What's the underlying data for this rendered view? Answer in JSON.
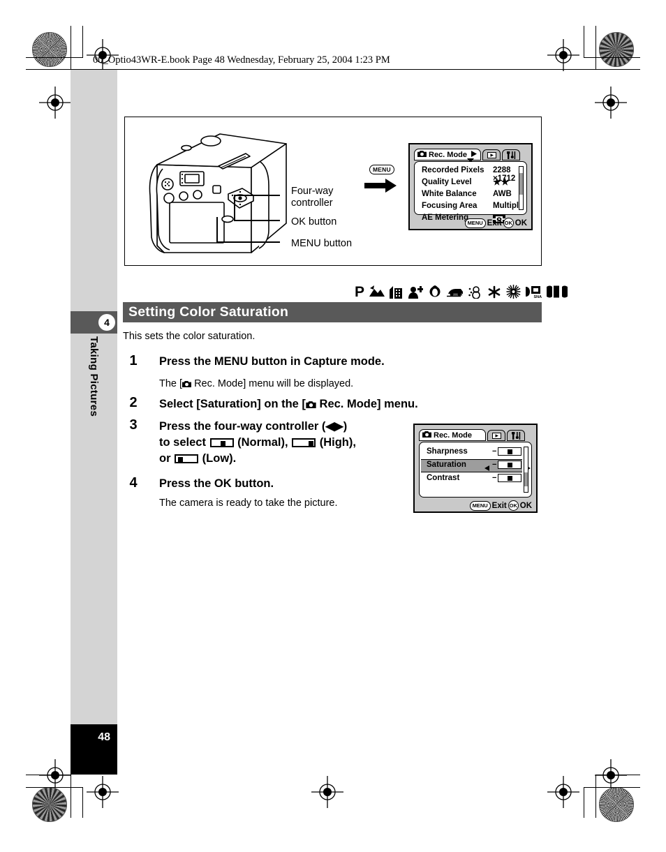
{
  "header": {
    "text": "00_Optio43WR-E.book  Page 48  Wednesday, February 25, 2004  1:23 PM"
  },
  "sidebar": {
    "chapter_number": "4",
    "chapter_title": "Taking Pictures",
    "page_number": "48"
  },
  "figure": {
    "callouts": [
      {
        "label": "Four-way\ncontroller",
        "line1": "Four-way",
        "line2": "controller"
      },
      {
        "label": "OK button"
      },
      {
        "label": "MENU button"
      }
    ],
    "callout_four_way_l1": "Four-way",
    "callout_four_way_l2": "controller",
    "callout_ok": "OK button",
    "callout_menu": "MENU button",
    "menu_token": "MENU"
  },
  "lcd_rec_mode": {
    "tab_title": "Rec. Mode",
    "tab_icons": [
      "camera-icon",
      "playback-icon",
      "tools-icon"
    ],
    "rows": [
      {
        "label": "Recorded Pixels",
        "value": "2288 ×1712"
      },
      {
        "label": "Quality Level",
        "value": "★★"
      },
      {
        "label": "White Balance",
        "value": "AWB"
      },
      {
        "label": "Focusing Area",
        "value": "Multiple"
      },
      {
        "label": "AE Metering",
        "value": "metering-icon"
      }
    ],
    "footer_menu": "MENU",
    "footer_exit": "Exit",
    "footer_ok_badge": "OK",
    "footer_ok": "OK"
  },
  "lcd_saturation": {
    "tab_title": "Rec. Mode",
    "rows": [
      {
        "label": "Sharpness",
        "minus": "−",
        "plus": "+",
        "knob": "center",
        "selected": false
      },
      {
        "label": "Saturation",
        "minus": "−",
        "plus": "+",
        "knob": "center",
        "selected": true
      },
      {
        "label": "Contrast",
        "minus": "−",
        "plus": "+",
        "knob": "center",
        "selected": false
      }
    ],
    "footer_menu": "MENU",
    "footer_exit": "Exit",
    "footer_ok_badge": "OK",
    "footer_ok": "OK"
  },
  "mode_icons": [
    "program-icon",
    "landscape-icon",
    "building-icon",
    "portrait-plus-icon",
    "flower-face-icon",
    "car-icon",
    "snowman-icon",
    "snowflake-icon",
    "sun-icon",
    "snap-icon",
    "panorama-icon"
  ],
  "section": {
    "heading": "Setting Color Saturation",
    "intro": "This sets the color saturation."
  },
  "steps": [
    {
      "number": "1",
      "title": "Press the MENU button in Capture mode.",
      "body_pre": "The [",
      "body_icon": "camera-icon",
      "body_post": " Rec. Mode] menu will be displayed."
    },
    {
      "number": "2",
      "title_pre": "Select [Saturation] on the [",
      "title_icon": "camera-icon",
      "title_post": " Rec. Mode] menu."
    },
    {
      "number": "3",
      "l1_pre": "Press the four-way controller (",
      "l1_arrows": "◀▶",
      "l1_post": ")",
      "l2_pre": "to select ",
      "l2_mid": " (Normal), ",
      "l2_post": " (High),",
      "l3_pre": "or ",
      "l3_post": " (Low)."
    },
    {
      "number": "4",
      "title": "Press the OK button.",
      "body": "The camera is ready to take the picture."
    }
  ],
  "colors": {
    "heading_bar": "#595959",
    "sidebar": "#d4d4d4",
    "lcd_bg": "#c9c9c9",
    "highlight": "#9d9d9d"
  }
}
